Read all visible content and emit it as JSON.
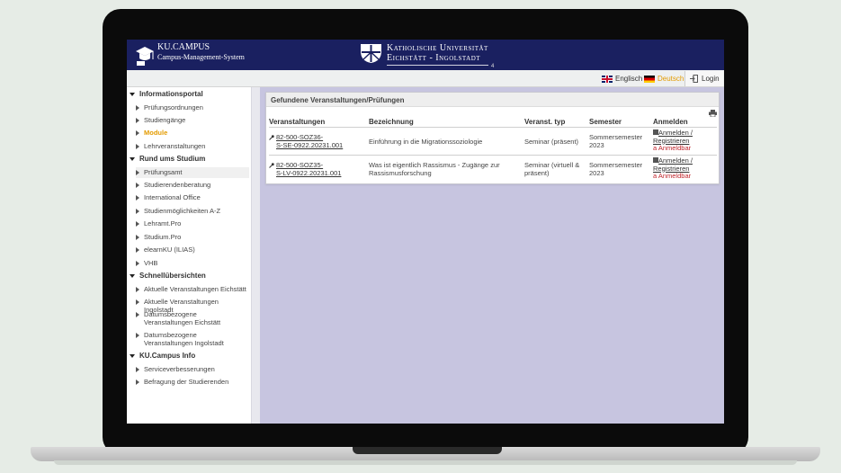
{
  "header": {
    "brand_name": "KU.CAMPUS",
    "brand_sub": "Campus-Management-System",
    "uni_line1": "Katholische Universität",
    "uni_line2": "Eichstätt - Ingolstadt",
    "mark": "4"
  },
  "langbar": {
    "english": "Englisch",
    "german": "Deutsch",
    "login": "Login"
  },
  "sidebar": {
    "sections": [
      {
        "title": "Informationsportal",
        "items": [
          "Prüfungsordnungen",
          "Studiengänge",
          "Module",
          "Lehrveranstaltungen"
        ]
      },
      {
        "title": "Rund ums Studium",
        "items": [
          "Prüfungsamt",
          "Studierendenberatung",
          "International Office",
          "Studienmöglichkeiten A-Z",
          "Lehramt.Pro",
          "Studium.Pro",
          "elearnKU (ILIAS)",
          "VHB"
        ]
      },
      {
        "title": "Schnellübersichten",
        "items": [
          "Aktuelle Veranstaltungen Eichstätt",
          "Aktuelle Veranstaltungen Ingolstadt",
          "Datumsbezogene Veranstaltungen Eichstätt",
          "Datumsbezogene Veranstaltungen Ingolstadt"
        ]
      },
      {
        "title": "KU.Campus Info",
        "items": [
          "Serviceverbesserungen",
          "Befragung der Studierenden"
        ]
      }
    ],
    "active_item": "Module"
  },
  "panel": {
    "title": "Gefundene Veranstaltungen/Prüfungen",
    "columns": [
      "Veranstaltungen",
      "Bezeichnung",
      "Veranst. typ",
      "Semester",
      "Anmelden"
    ],
    "rows": [
      {
        "code_l1": "82-500-SOZ36-",
        "code_l2": "S-SE-0922.20231.001",
        "title": "Einführung in die Migrationssoziologie",
        "type_l1": "Seminar (präsent)",
        "type_l2": "",
        "sem_l1": "Sommersemester",
        "sem_l2": "2023",
        "reg_l1": "Anmelden /",
        "reg_l2": "Registrieren",
        "status": "a Anmeldbar"
      },
      {
        "code_l1": "82-500-SOZ35-",
        "code_l2": "S-LV-0922.20231.001",
        "title_l1": "Was ist eigentlich Rassismus - Zugänge zur",
        "title_l2": "Rassismusforschung",
        "type_l1": "Seminar (virtuell &",
        "type_l2": "präsent)",
        "sem_l1": "Sommersemester",
        "sem_l2": "2023",
        "reg_l1": "Anmelden /",
        "reg_l2": "Registrieren",
        "status": "a Anmeldbar"
      }
    ]
  }
}
